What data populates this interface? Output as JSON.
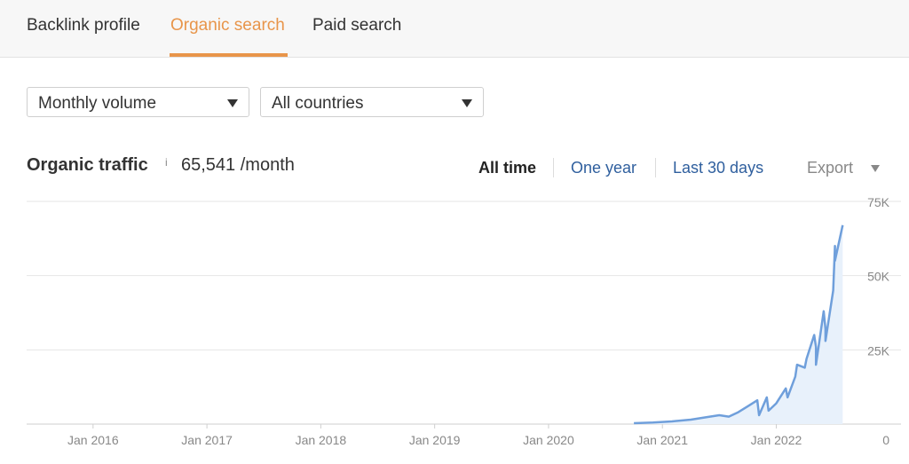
{
  "tabs": [
    {
      "label": "Backlink profile",
      "active": false
    },
    {
      "label": "Organic search",
      "active": true
    },
    {
      "label": "Paid search",
      "active": false
    }
  ],
  "filters": {
    "volume": "Monthly volume",
    "country": "All countries"
  },
  "traffic": {
    "title": "Organic traffic",
    "info_icon": "i",
    "value": "65,541",
    "unit": "/month"
  },
  "ranges": {
    "all_time": "All time",
    "one_year": "One year",
    "last_30_days": "Last 30 days"
  },
  "export_label": "Export",
  "colors": {
    "accent": "#e8954a",
    "link": "#2f5f9e",
    "series": "#6f9fdb",
    "area": "#e8f1fb"
  },
  "icons": [
    "chevron-down-icon",
    "info-icon"
  ],
  "chart_data": {
    "type": "area",
    "title": "",
    "xlabel": "",
    "ylabel": "",
    "x_ticks": [
      "Jan 2016",
      "Jan 2017",
      "Jan 2018",
      "Jan 2019",
      "Jan 2020",
      "Jan 2021",
      "Jan 2022"
    ],
    "y_ticks": [
      "75K",
      "50K",
      "25K",
      "0"
    ],
    "y_tick_values": [
      75000,
      50000,
      25000,
      0
    ],
    "xlim": [
      "2015-06",
      "2022-09"
    ],
    "ylim": [
      0,
      75000
    ],
    "y_axis_position": "right",
    "grid": true,
    "series": [
      {
        "x": [
          "2020-10",
          "2020-12",
          "2021-02",
          "2021-04",
          "2021-06",
          "2021-07",
          "2021-08",
          "2021-09",
          "2021-10",
          "2021-11",
          "2021-11",
          "2021-12",
          "2021-12",
          "2022-01",
          "2022-02",
          "2022-02",
          "2022-03",
          "2022-03",
          "2022-04",
          "2022-04",
          "2022-05",
          "2022-05",
          "2022-05",
          "2022-06",
          "2022-06",
          "2022-06",
          "2022-07",
          "2022-07",
          "2022-07",
          "2022-08"
        ],
        "y": [
          300,
          500,
          900,
          1500,
          2500,
          3000,
          2500,
          4000,
          6000,
          8000,
          3000,
          9000,
          4500,
          7000,
          12000,
          9000,
          16000,
          20000,
          19000,
          22000,
          30000,
          26000,
          20000,
          38000,
          32000,
          28000,
          45000,
          60000,
          55000,
          67000
        ]
      }
    ]
  }
}
